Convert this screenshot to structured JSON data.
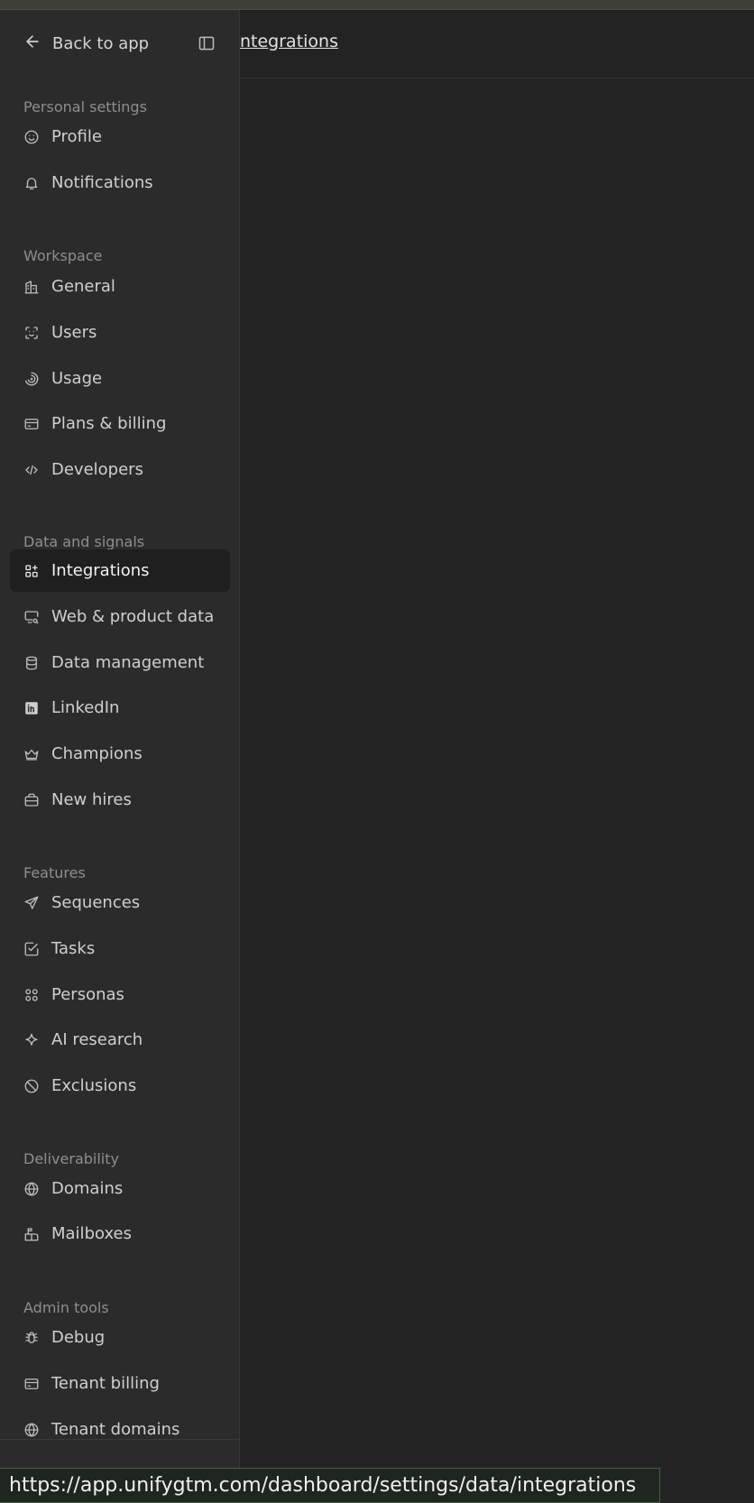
{
  "breadcrumb": {
    "current": "ntegrations"
  },
  "sidebar": {
    "back_label": "Back to app",
    "sections": [
      {
        "title": "Personal settings",
        "items": [
          {
            "label": "Profile",
            "icon": "smile-icon"
          },
          {
            "label": "Notifications",
            "icon": "bell-icon"
          }
        ]
      },
      {
        "title": "Workspace",
        "items": [
          {
            "label": "General",
            "icon": "building-icon"
          },
          {
            "label": "Users",
            "icon": "user-scan-icon"
          },
          {
            "label": "Usage",
            "icon": "spiral-gauge-icon"
          },
          {
            "label": "Plans & billing",
            "icon": "credit-card-icon"
          },
          {
            "label": "Developers",
            "icon": "code-icon"
          }
        ]
      },
      {
        "title": "Data and signals",
        "items": [
          {
            "label": "Integrations",
            "icon": "grid-plus-icon",
            "active": true
          },
          {
            "label": "Web & product data",
            "icon": "monitor-search-icon"
          },
          {
            "label": "Data management",
            "icon": "database-icon"
          },
          {
            "label": "LinkedIn",
            "icon": "linkedin-icon"
          },
          {
            "label": "Champions",
            "icon": "crown-icon"
          },
          {
            "label": "New hires",
            "icon": "briefcase-icon"
          }
        ]
      },
      {
        "title": "Features",
        "items": [
          {
            "label": "Sequences",
            "icon": "send-icon"
          },
          {
            "label": "Tasks",
            "icon": "check-square-icon"
          },
          {
            "label": "Personas",
            "icon": "persona-grid-icon"
          },
          {
            "label": "AI research",
            "icon": "sparkle-icon"
          },
          {
            "label": "Exclusions",
            "icon": "ban-icon"
          }
        ]
      },
      {
        "title": "Deliverability",
        "items": [
          {
            "label": "Domains",
            "icon": "globe-icon"
          },
          {
            "label": "Mailboxes",
            "icon": "mailbox-icon"
          }
        ]
      },
      {
        "title": "Admin tools",
        "items": [
          {
            "label": "Debug",
            "icon": "bug-icon"
          },
          {
            "label": "Tenant billing",
            "icon": "credit-card-icon"
          },
          {
            "label": "Tenant domains",
            "icon": "globe-icon"
          }
        ]
      }
    ]
  },
  "status_bar": {
    "url": "https://app.unifygtm.com/dashboard/settings/data/integrations"
  },
  "colors": {
    "sidebar_bg": "#2b2b2b",
    "main_bg": "#232323",
    "active_item_bg": "#1f1f1f"
  }
}
